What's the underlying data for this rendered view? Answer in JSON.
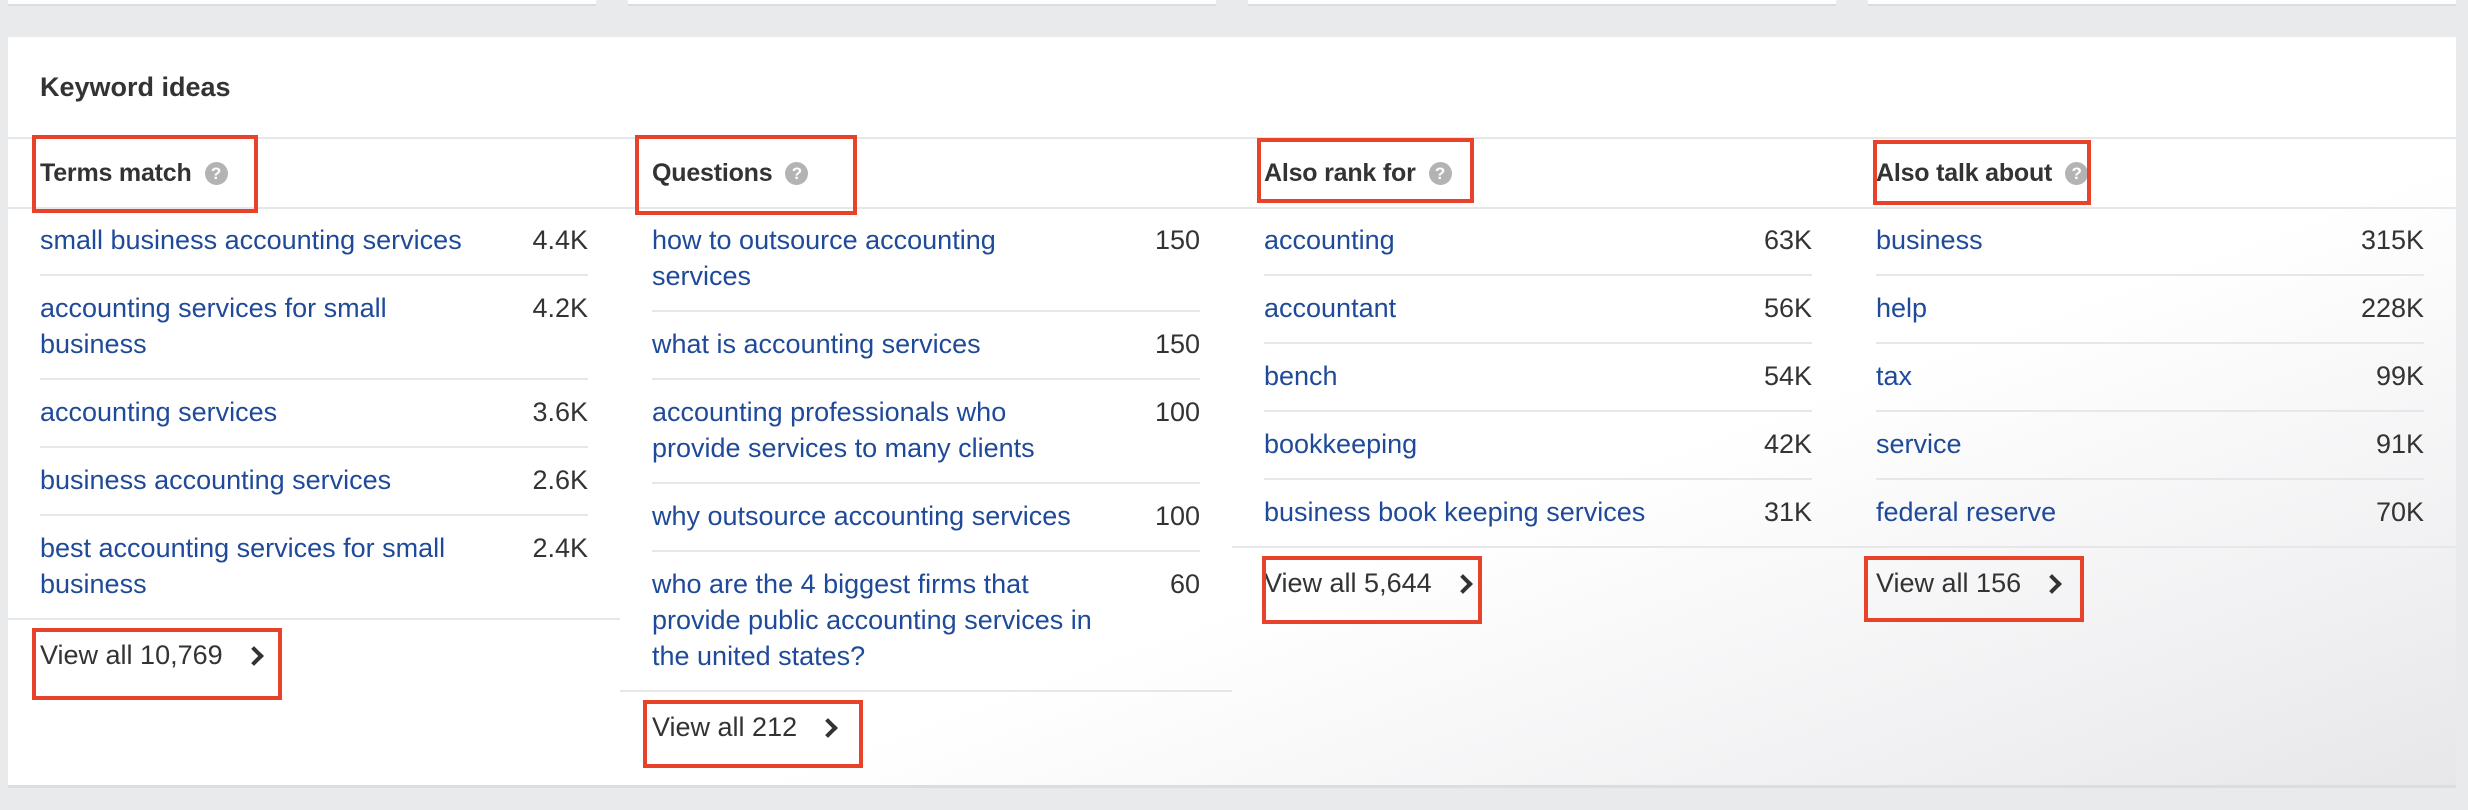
{
  "panel": {
    "title": "Keyword ideas"
  },
  "columns": [
    {
      "title": "Terms match",
      "rows": [
        {
          "keyword": "small business accounting services",
          "volume": "4.4K"
        },
        {
          "keyword": "accounting services for small business",
          "volume": "4.2K"
        },
        {
          "keyword": "accounting services",
          "volume": "3.6K"
        },
        {
          "keyword": "business accounting services",
          "volume": "2.6K"
        },
        {
          "keyword": "best accounting services for small business",
          "volume": "2.4K"
        }
      ],
      "view_all": "View all 10,769"
    },
    {
      "title": "Questions",
      "rows": [
        {
          "keyword": "how to outsource accounting services",
          "volume": "150"
        },
        {
          "keyword": "what is accounting services",
          "volume": "150"
        },
        {
          "keyword": "accounting professionals who provide services to many clients",
          "volume": "100"
        },
        {
          "keyword": "why outsource accounting services",
          "volume": "100"
        },
        {
          "keyword": "who are the 4 biggest firms that provide public accounting services in the united states?",
          "volume": "60"
        }
      ],
      "view_all": "View all 212"
    },
    {
      "title": "Also rank for",
      "rows": [
        {
          "keyword": "accounting",
          "volume": "63K"
        },
        {
          "keyword": "accountant",
          "volume": "56K"
        },
        {
          "keyword": "bench",
          "volume": "54K"
        },
        {
          "keyword": "bookkeeping",
          "volume": "42K"
        },
        {
          "keyword": "business book keeping services",
          "volume": "31K"
        }
      ],
      "view_all": "View all 5,644"
    },
    {
      "title": "Also talk about",
      "rows": [
        {
          "keyword": "business",
          "volume": "315K"
        },
        {
          "keyword": "help",
          "volume": "228K"
        },
        {
          "keyword": "tax",
          "volume": "99K"
        },
        {
          "keyword": "service",
          "volume": "91K"
        },
        {
          "keyword": "federal reserve",
          "volume": "70K"
        }
      ],
      "view_all": "View all 156"
    }
  ],
  "icons": {
    "help": "?",
    "chevron": "chevron-right"
  },
  "colors": {
    "link": "#1f4a9a",
    "annotation": "#e8432a",
    "help_icon": "#b3b3b3"
  }
}
